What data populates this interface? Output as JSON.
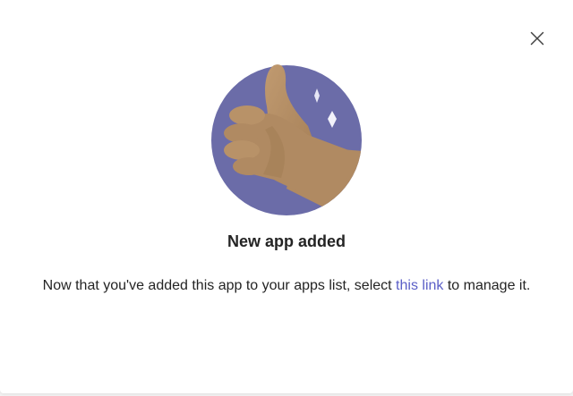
{
  "dialog": {
    "close_icon": "close-icon",
    "hero_icon": "thumbs-up-illustration",
    "title": "New app added",
    "message_before": "Now that you've added this app to your apps list, select",
    "link_text": "this link",
    "message_after": "to manage it."
  },
  "colors": {
    "circle": "#6b6ca8",
    "hand": "#b08a62",
    "link": "#5b5fc7",
    "text": "#242424"
  }
}
